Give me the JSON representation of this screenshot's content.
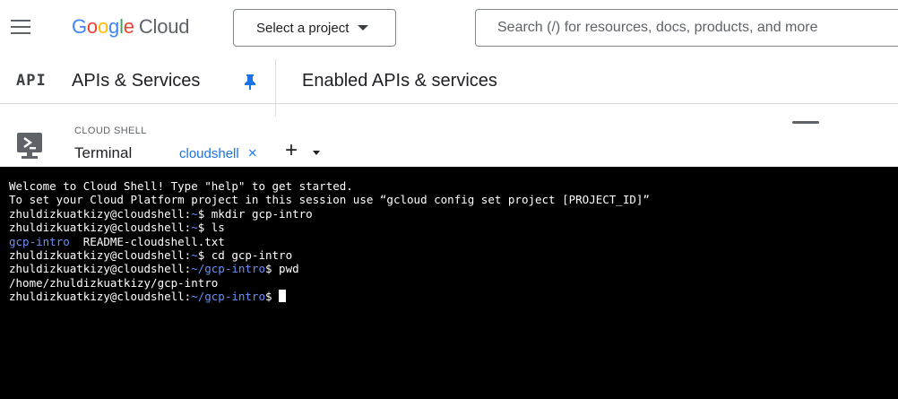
{
  "header": {
    "logo_google": [
      "G",
      "o",
      "o",
      "g",
      "l",
      "e"
    ],
    "logo_cloud": "Cloud",
    "project_select_label": "Select a project",
    "search_placeholder": "Search (/) for resources, docs, products, and more"
  },
  "nav": {
    "api_glyph": "API",
    "product_name": "APIs & Services",
    "page_title": "Enabled APIs & services"
  },
  "cloud_shell": {
    "small_label": "CLOUD SHELL",
    "big_label": "Terminal",
    "tab_label": "cloudshell",
    "tab_close": "×",
    "add_tab": "+"
  },
  "terminal": {
    "lines": [
      [
        {
          "text": "Welcome to Cloud Shell! Type \"help\" to get started."
        }
      ],
      [
        {
          "text": "To set your Cloud Platform project in this session use “gcloud config set project [PROJECT_ID]”"
        }
      ],
      [
        {
          "text": "zhuldizkuatkizy@cloudshell:"
        },
        {
          "text": "~",
          "color": "blue"
        },
        {
          "text": "$ mkdir gcp-intro"
        }
      ],
      [
        {
          "text": "zhuldizkuatkizy@cloudshell:"
        },
        {
          "text": "~",
          "color": "blue"
        },
        {
          "text": "$ ls"
        }
      ],
      [
        {
          "text": "gcp-intro",
          "color": "blue"
        },
        {
          "text": "  README-cloudshell.txt"
        }
      ],
      [
        {
          "text": "zhuldizkuatkizy@cloudshell:"
        },
        {
          "text": "~",
          "color": "blue"
        },
        {
          "text": "$ cd gcp-intro"
        }
      ],
      [
        {
          "text": "zhuldizkuatkizy@cloudshell:"
        },
        {
          "text": "~/gcp-intro",
          "color": "blue"
        },
        {
          "text": "$ pwd"
        }
      ],
      [
        {
          "text": "/home/zhuldizkuatkizy/gcp-intro"
        }
      ],
      [
        {
          "text": "zhuldizkuatkizy@cloudshell:"
        },
        {
          "text": "~/gcp-intro",
          "color": "blue"
        },
        {
          "text": "$ "
        }
      ]
    ]
  },
  "colors": {
    "google_blue": "#4285F4",
    "google_red": "#EA4335",
    "google_yellow": "#FBBC05",
    "google_green": "#34A853",
    "accent_blue": "#1a73e8",
    "terminal_bg": "#000000",
    "terminal_path_blue": "#6b8ff8"
  }
}
